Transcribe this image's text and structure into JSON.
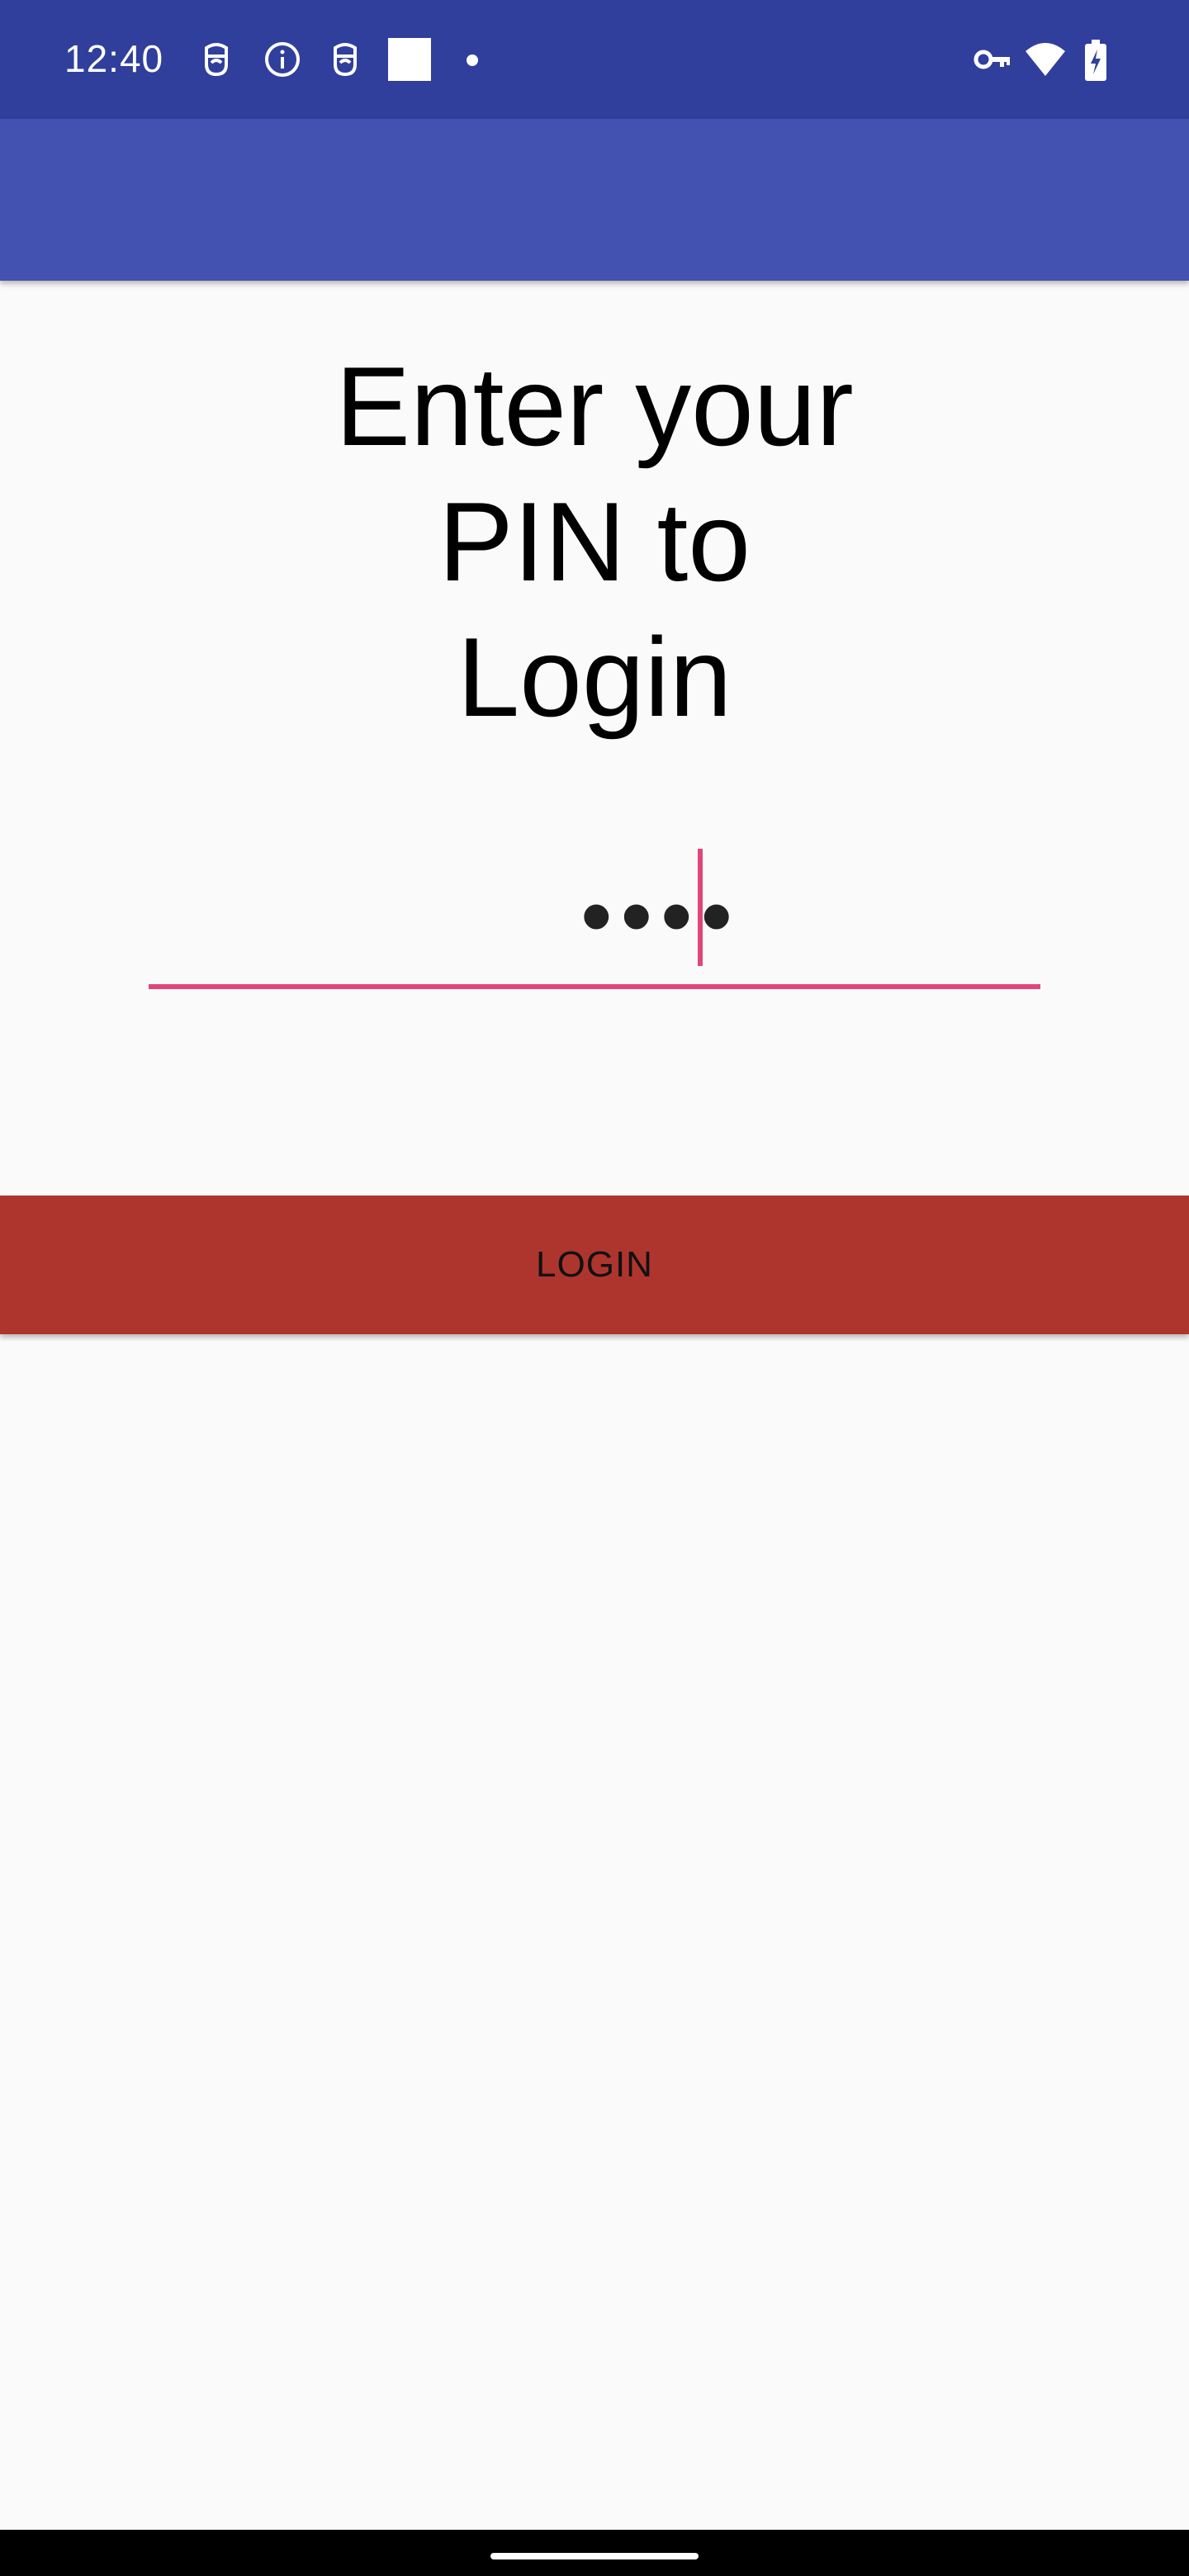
{
  "status_bar": {
    "time": "12:40",
    "icons": [
      "face-unlock-icon",
      "info-icon",
      "face-unlock-icon",
      "square-icon",
      "notification-dot-icon",
      "vpn-key-icon",
      "wifi-icon",
      "battery-charging-icon"
    ],
    "background": "#303f9b"
  },
  "app_bar": {
    "background": "#4351b0"
  },
  "main": {
    "heading_lines": [
      "Enter your",
      "PIN to",
      "Login"
    ],
    "pin_value_masked": "••••",
    "accent": "#e0457b"
  },
  "login_button": {
    "label": "LOGIN",
    "background": "#ae352e"
  }
}
